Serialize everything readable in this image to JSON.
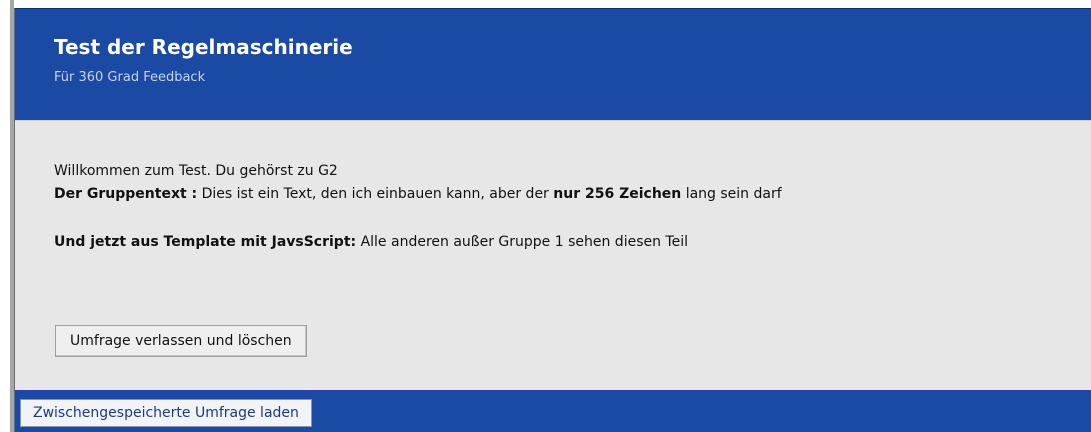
{
  "header": {
    "title": "Test der Regelmaschinerie",
    "subtitle": "Für 360 Grad Feedback"
  },
  "content": {
    "welcome_line": "Willkommen zum Test. Du gehörst zu G2",
    "group_text_label": "Der Gruppentext :",
    "group_text_part1": " Dies ist ein Text, den ich einbauen kann, aber der ",
    "group_text_bold": "nur 256 Zeichen",
    "group_text_part2": " lang sein darf",
    "template_label": "Und jetzt aus Template mit JavsScript:",
    "template_text": " Alle anderen außer Gruppe 1 sehen diesen Teil",
    "leave_button_label": "Umfrage verlassen und löschen"
  },
  "footer": {
    "load_button_label": "Zwischengespeicherte Umfrage laden"
  },
  "colors": {
    "header_bg": "#1a4aa3",
    "content_bg": "#e7e7e7"
  }
}
